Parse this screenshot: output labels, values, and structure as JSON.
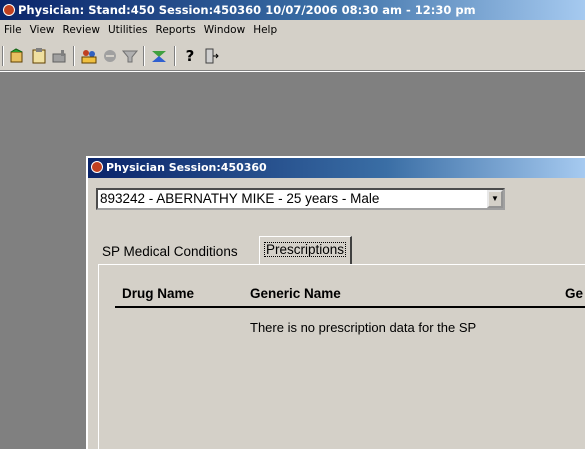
{
  "app": {
    "title": "Physician: Stand:450 Session:450360 10/07/2006 08:30 am - 12:30 pm"
  },
  "menu": [
    "File",
    "View",
    "Review",
    "Utilities",
    "Reports",
    "Window",
    "Help"
  ],
  "toolbar": {
    "icons": [
      "new-icon",
      "clipboard-icon",
      "edit-icon",
      "people-icon",
      "stop-icon",
      "funnel-icon",
      "chart-icon",
      "help-icon",
      "exit-icon"
    ]
  },
  "child_window": {
    "title": "Physician Session:450360",
    "participant_select": "893242 - ABERNATHY MIKE - 25  years  - Male",
    "tabs": [
      "SP Medical Conditions",
      "Prescriptions"
    ],
    "active_tab": "Prescriptions",
    "table": {
      "columns": [
        "Drug Name",
        "Generic Name",
        "Ge"
      ],
      "empty_message": "There is no prescription data for the SP"
    }
  }
}
